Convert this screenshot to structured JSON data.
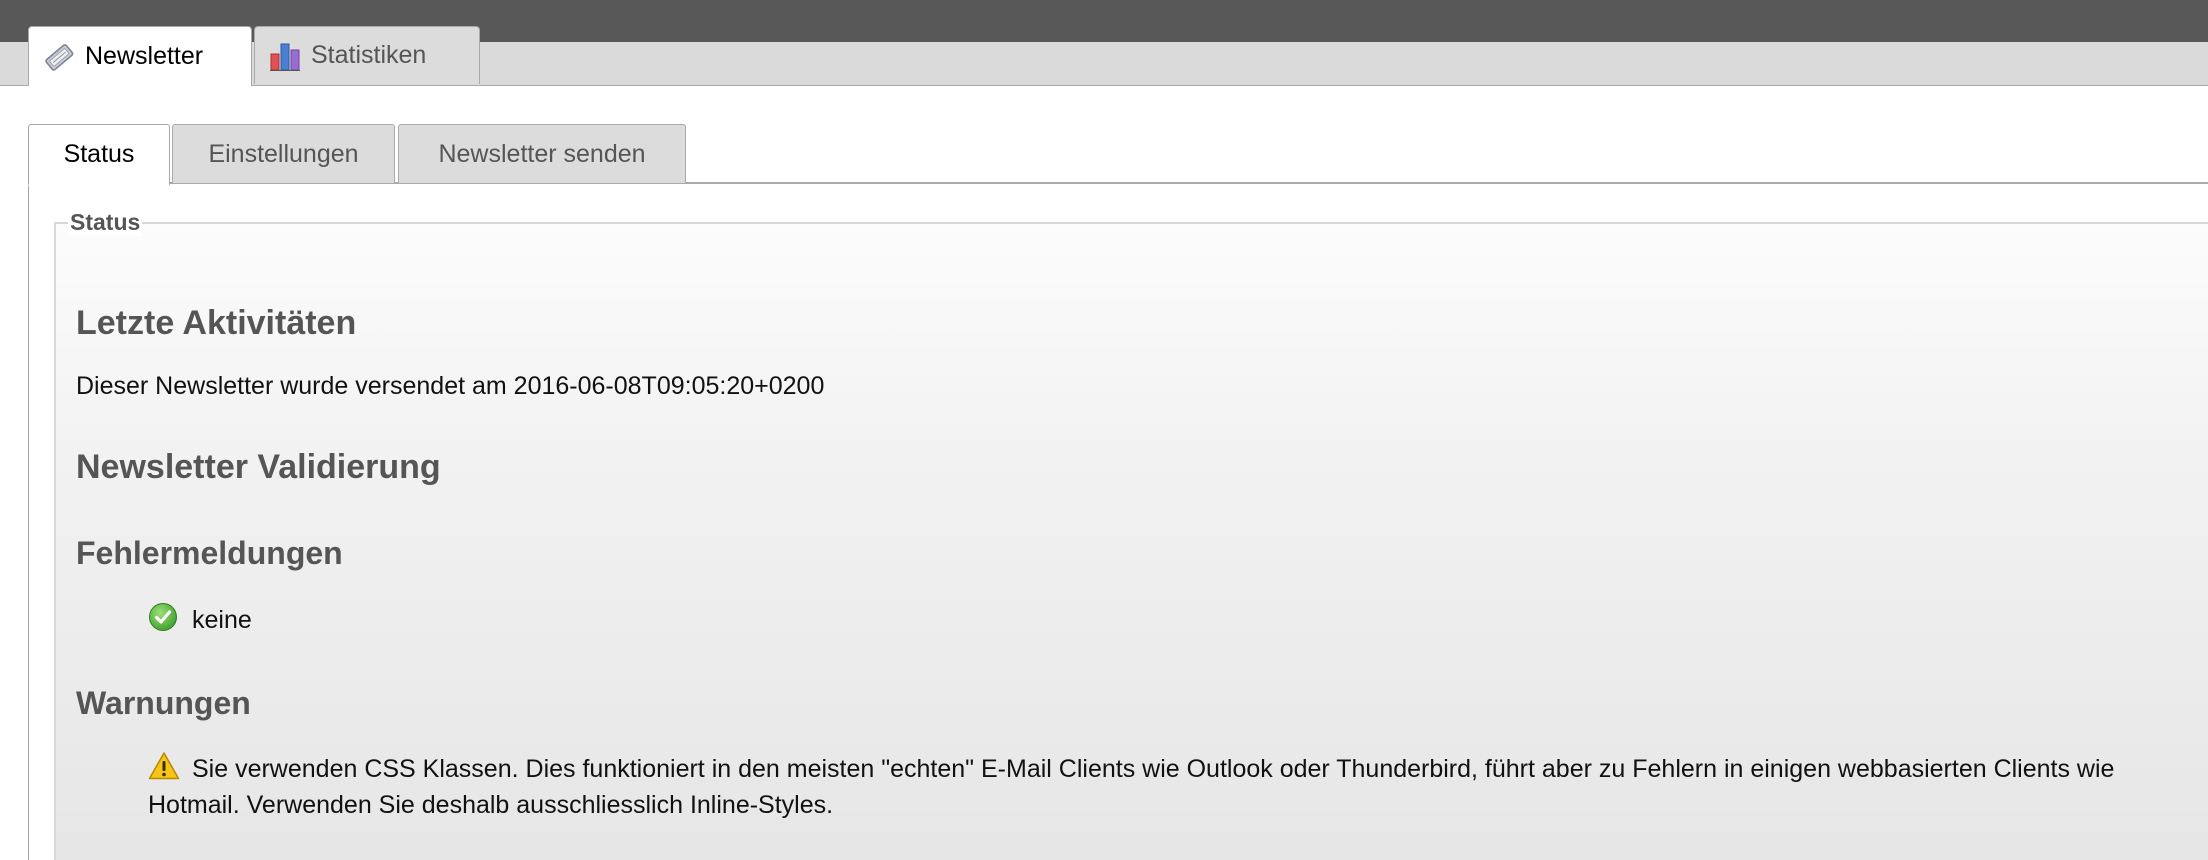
{
  "main_tabs": [
    {
      "label": "Newsletter",
      "icon": "newsletter-icon",
      "active": true
    },
    {
      "label": "Statistiken",
      "icon": "bar-chart-icon",
      "active": false
    }
  ],
  "sub_tabs": [
    {
      "label": "Status",
      "active": true
    },
    {
      "label": "Einstellungen",
      "active": false
    },
    {
      "label": "Newsletter senden",
      "active": false
    }
  ],
  "status_panel": {
    "legend": "Status",
    "last_activities_heading": "Letzte Aktivitäten",
    "last_activities_text": "Dieser Newsletter wurde versendet am 2016-06-08T09:05:20+0200",
    "validation_heading": "Newsletter Validierung",
    "errors_heading": "Fehlermeldungen",
    "errors_item": "keine",
    "warnings_heading": "Warnungen",
    "warnings_item": "Sie verwenden CSS Klassen. Dies funktioniert in den meisten \"echten\" E-Mail Clients wie Outlook oder Thunderbird, führt aber zu Fehlern in einigen webbasierten Clients wie Hotmail. Verwenden Sie deshalb ausschliesslich Inline-Styles."
  },
  "colors": {
    "topbar": "#585858",
    "tabstrip": "#dadada",
    "heading": "#555555",
    "success": "#5cb85c",
    "warning": "#f0c419"
  }
}
